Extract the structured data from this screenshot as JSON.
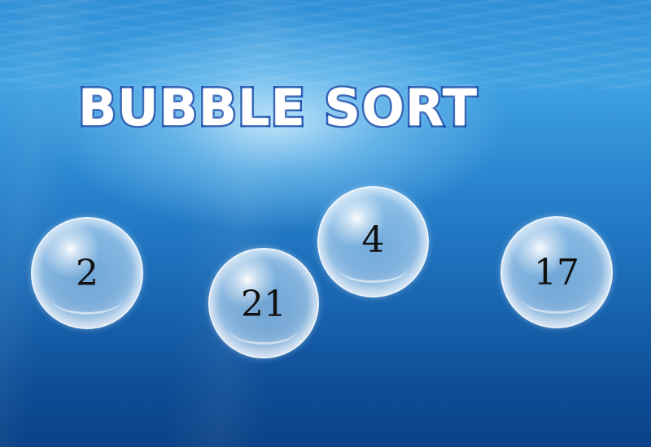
{
  "title": "BUBBLE SORT",
  "bubbles": [
    {
      "value": "2"
    },
    {
      "value": "21"
    },
    {
      "value": "4"
    },
    {
      "value": "17"
    }
  ],
  "colors": {
    "title_fill": "#ffffff",
    "title_outline": "#0a45a8",
    "water_top": "#2f8fd6",
    "water_bottom": "#0b4287",
    "bubble_text": "#111111"
  }
}
